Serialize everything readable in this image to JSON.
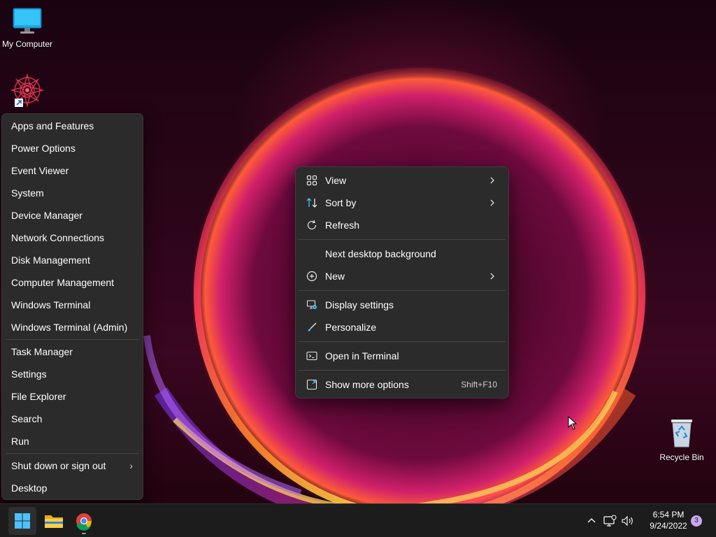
{
  "desktop": {
    "icons": [
      {
        "label": "My Computer",
        "icon": "monitor-icon"
      },
      {
        "label": "",
        "icon": "app-shortcut-icon"
      },
      {
        "label": "Recycle Bin",
        "icon": "recycle-bin-icon"
      }
    ]
  },
  "winx_menu": {
    "items": [
      {
        "label": "Apps and Features"
      },
      {
        "label": "Power Options"
      },
      {
        "label": "Event Viewer"
      },
      {
        "label": "System"
      },
      {
        "label": "Device Manager"
      },
      {
        "label": "Network Connections"
      },
      {
        "label": "Disk Management"
      },
      {
        "label": "Computer Management"
      },
      {
        "label": "Windows Terminal"
      },
      {
        "label": "Windows Terminal (Admin)"
      },
      {
        "label": "Task Manager"
      },
      {
        "label": "Settings"
      },
      {
        "label": "File Explorer"
      },
      {
        "label": "Search"
      },
      {
        "label": "Run"
      },
      {
        "label": "Shut down or sign out",
        "submenu": true
      },
      {
        "label": "Desktop"
      }
    ]
  },
  "context_menu": {
    "items": [
      {
        "label": "View",
        "icon": "grid-icon",
        "submenu": true
      },
      {
        "label": "Sort by",
        "icon": "sort-arrows-icon",
        "submenu": true
      },
      {
        "label": "Refresh",
        "icon": "refresh-icon"
      },
      {
        "label": "Next desktop background"
      },
      {
        "label": "New",
        "icon": "plus-circle-icon",
        "submenu": true
      },
      {
        "label": "Display settings",
        "icon": "display-settings-icon"
      },
      {
        "label": "Personalize",
        "icon": "brush-icon"
      },
      {
        "label": "Open in Terminal",
        "icon": "terminal-icon"
      },
      {
        "label": "Show more options",
        "icon": "more-options-icon",
        "shortcut": "Shift+F10"
      }
    ]
  },
  "taskbar": {
    "apps": [
      {
        "name": "Start",
        "icon": "windows-logo-icon"
      },
      {
        "name": "File Explorer",
        "icon": "folder-icon"
      },
      {
        "name": "Google Chrome",
        "icon": "chrome-icon"
      }
    ],
    "tray": [
      "chevron-up-icon",
      "network-icon",
      "volume-icon"
    ],
    "time": "6:54 PM",
    "date": "9/24/2022",
    "notification_count": "3"
  },
  "colors": {
    "menu_bg": "#2b2b2b",
    "taskbar_bg": "#1c1c1c",
    "accent_blue": "#4cc2ff"
  }
}
